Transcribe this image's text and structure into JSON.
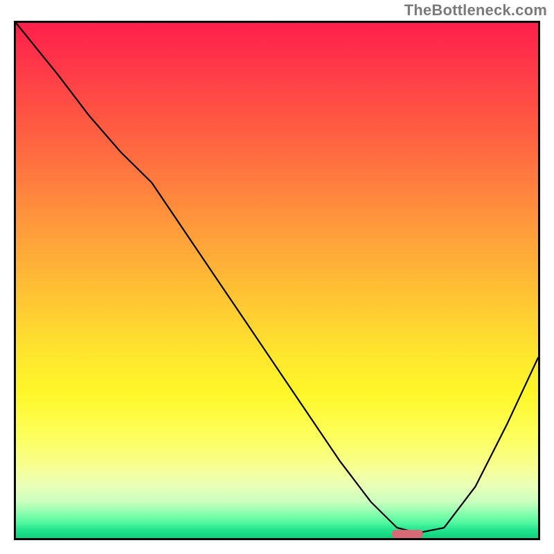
{
  "watermark": "TheBottleneck.com",
  "colors": {
    "gradient_top": "#ff1f4b",
    "gradient_mid": "#ffe52e",
    "gradient_bottom": "#0fd07e",
    "curve": "#000000",
    "marker": "#d76a74",
    "border": "#000000"
  },
  "chart_data": {
    "type": "line",
    "title": "",
    "xlabel": "",
    "ylabel": "",
    "xlim": [
      0,
      100
    ],
    "ylim": [
      0,
      100
    ],
    "grid": false,
    "legend": false,
    "series": [
      {
        "name": "bottleneck-curve",
        "x": [
          0,
          8,
          14,
          20,
          26,
          32,
          38,
          44,
          50,
          56,
          62,
          68,
          73,
          77,
          82,
          88,
          94,
          100
        ],
        "values": [
          100,
          90,
          82,
          75,
          69,
          60,
          51,
          42,
          33,
          24,
          15,
          7,
          2,
          1,
          2,
          10,
          22,
          35
        ]
      }
    ],
    "annotations": [
      {
        "name": "optimal-marker",
        "shape": "rounded-bar",
        "x_center": 75,
        "y": 0.8,
        "width": 6,
        "height": 1.6,
        "color": "#d76a74"
      }
    ]
  }
}
